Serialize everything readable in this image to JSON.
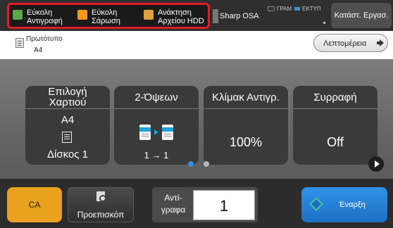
{
  "topbar": {
    "apps": [
      {
        "label": "Εύκολη\nΑντιγραφή",
        "icon": "copy-icon"
      },
      {
        "label": "Εύκολη\nΣάρωση",
        "icon": "scan-icon"
      },
      {
        "label": "Ανάκτηση\nΑρχείου HDD",
        "icon": "folder-icon"
      },
      {
        "label": "Sharp OSA",
        "icon": "app-icon"
      }
    ],
    "status_mode": "ΓΡΑΜ",
    "status_print": "ΕΚΤΥΠ",
    "job_status_label": "Κατάστ. Εργασ.",
    "highlight_color": "#e01b2b"
  },
  "original": {
    "title": "Πρωτότυπο",
    "size": "A4",
    "details_label": "Λεπτομέρεια"
  },
  "cards": {
    "paper": {
      "title": "Επιλογή\nΧαρτιού",
      "size": "A4",
      "tray": "Δίσκος 1"
    },
    "duplex": {
      "title": "2-Όψεων",
      "value": "1 → 1"
    },
    "scale": {
      "title": "Κλίμακ Αντιγρ.",
      "value": "100%"
    },
    "combine": {
      "title": "Συρραφή",
      "value": "Off"
    }
  },
  "pager": {
    "pages": 2,
    "active": 1
  },
  "bottom": {
    "ca_label": "CA",
    "preview_label": "Προεπισκόπ",
    "copies_label": "Αντί-\nγραφα",
    "copies_value": "1",
    "start_label": "Έναρξη"
  },
  "colors": {
    "ca": "#e8a21e",
    "start": "#2f93e6",
    "active_dot": "#2f8fe0"
  }
}
